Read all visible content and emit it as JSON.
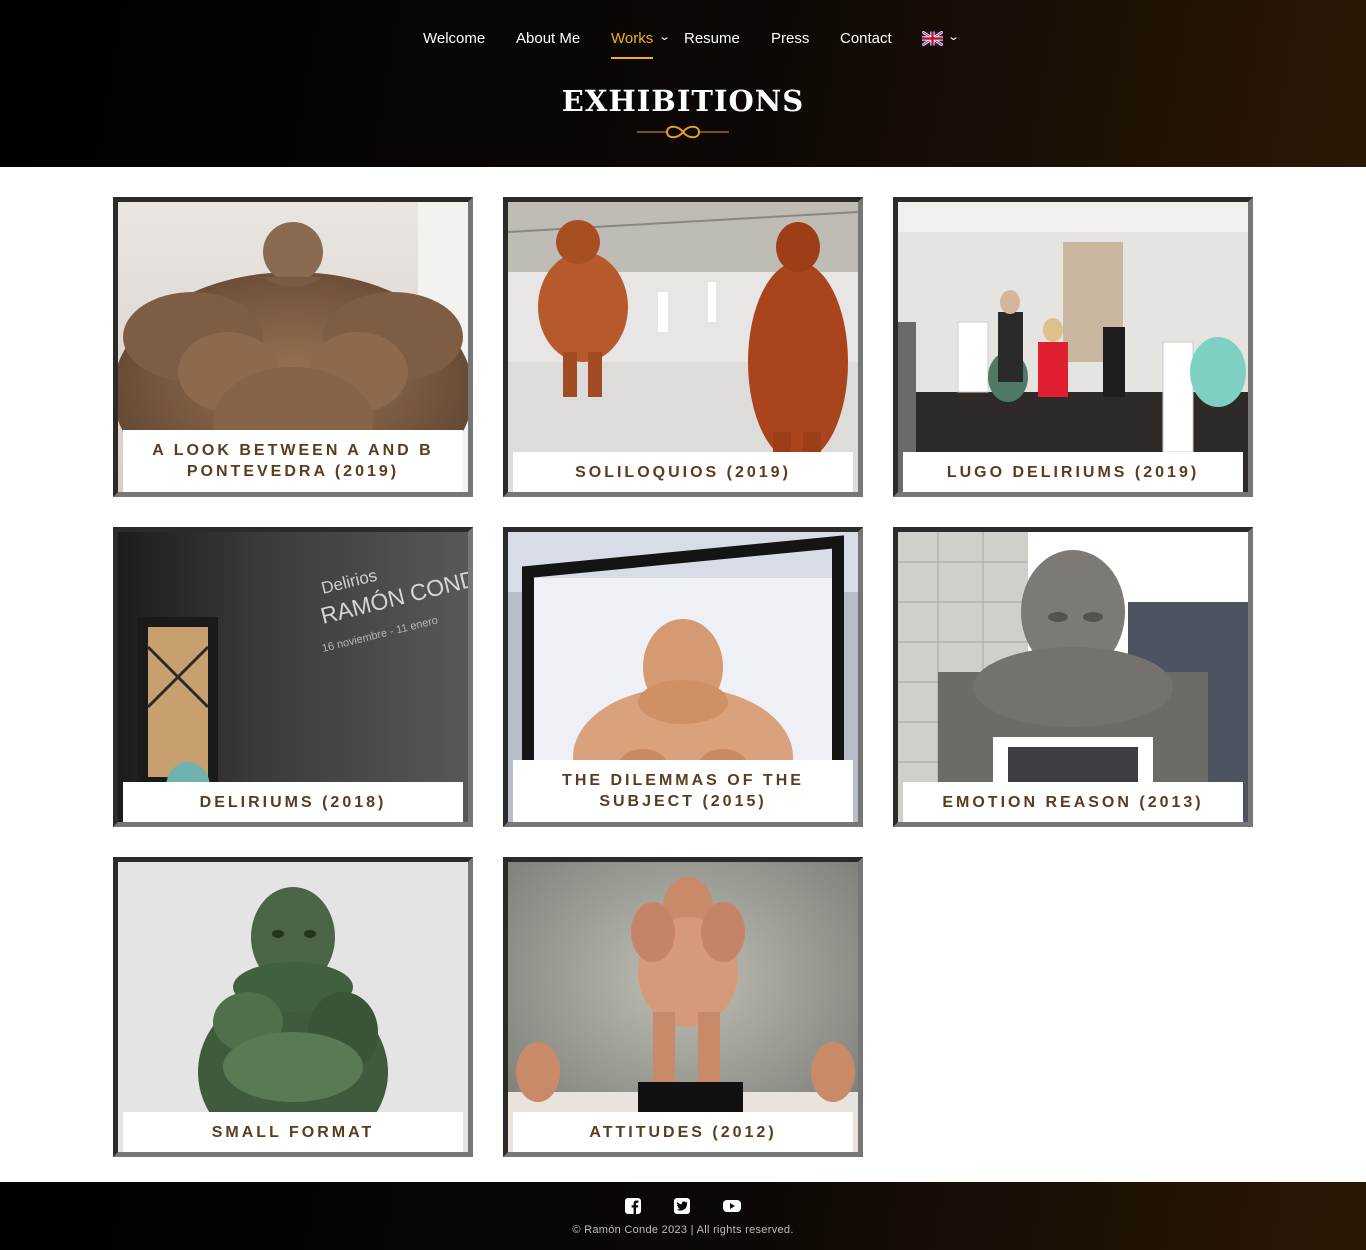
{
  "nav": {
    "items": [
      {
        "label": "Welcome"
      },
      {
        "label": "About Me"
      },
      {
        "label": "Works"
      },
      {
        "label": "Resume"
      },
      {
        "label": "Press"
      },
      {
        "label": "Contact"
      }
    ],
    "active_color": "#f0b020",
    "language_icon": "uk-flag-icon"
  },
  "page": {
    "title": "EXHIBITIONS",
    "divider_icon": "infinity-icon",
    "divider_color": "#e0a020"
  },
  "exhibitions": [
    {
      "title": "A LOOK BETWEEN A AND B PONTEVEDRA (2019)"
    },
    {
      "title": "SOLILOQUIOS (2019)"
    },
    {
      "title": "LUGO DELIRIUMS (2019)"
    },
    {
      "title": "DELIRIUMS (2018)"
    },
    {
      "title": "THE DILEMMAS OF THE SUBJECT (2015)"
    },
    {
      "title": "EMOTION REASON (2013)"
    },
    {
      "title": "SMALL FORMAT"
    },
    {
      "title": "ATTITUDES (2012)"
    }
  ],
  "photo_text": {
    "line1": "Delirios",
    "line2": "RAMÓN CONDE",
    "line3": "16 noviembre - 11 enero"
  },
  "footer": {
    "social_icons": [
      "facebook-icon",
      "twitter-icon",
      "youtube-icon"
    ],
    "copyright": "© Ramón Conde 2023 | All rights reserved."
  }
}
